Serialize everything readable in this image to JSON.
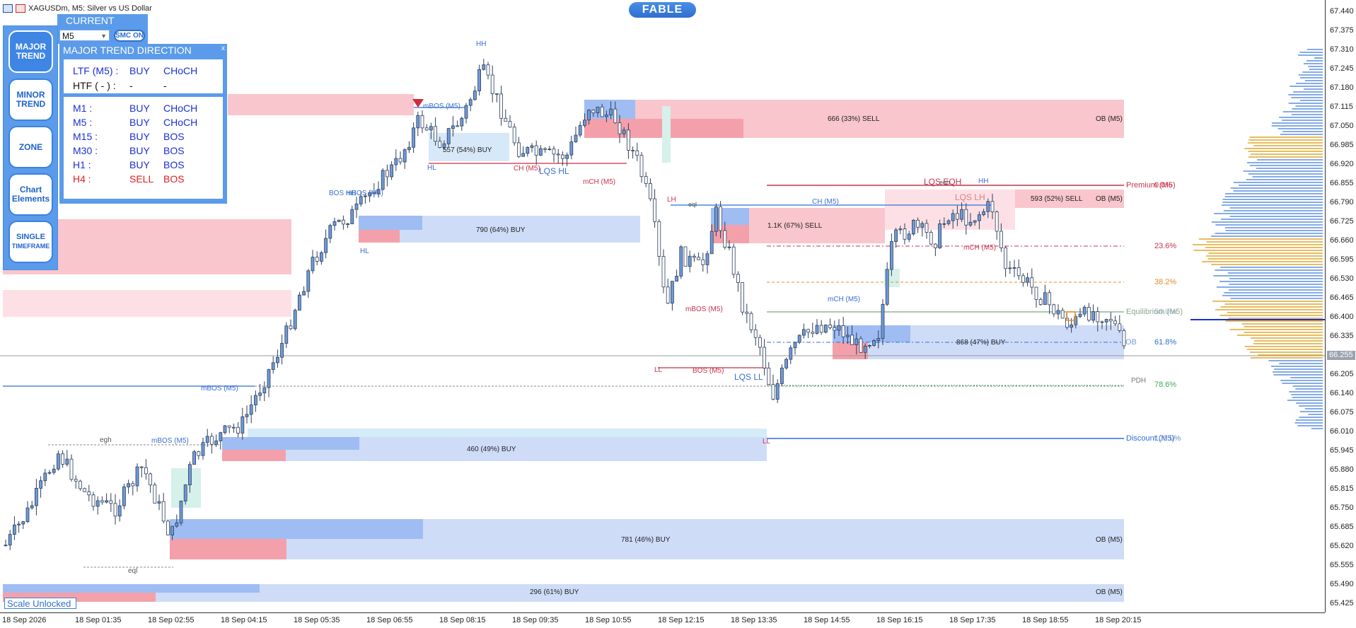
{
  "window": {
    "title": "XAGUSDm, M5:  Silver vs US Dollar",
    "brand": "FABLE"
  },
  "current": {
    "title": "CURRENT",
    "timeframe": "M5",
    "smc_label": "SMC ON"
  },
  "side_buttons": [
    {
      "label_line1": "MAJOR",
      "label_line2": "TREND",
      "active": true
    },
    {
      "label_line1": "MINOR",
      "label_line2": "TREND",
      "active": false
    },
    {
      "label_line1": "ZONE",
      "label_line2": "",
      "active": false
    },
    {
      "label_line1": "Chart",
      "label_line2": "Elements",
      "active": false
    },
    {
      "label_line1": "SINGLE",
      "label_line2": "TIMEFRAME",
      "active": false
    }
  ],
  "trend_panel": {
    "title": "MAJOR TREND DIRECTION",
    "close": "x",
    "rows_top": [
      {
        "tf": "LTF (M5) :",
        "dir": "BUY",
        "type": "CHoCH",
        "style": "blue"
      },
      {
        "tf": "HTF ( - ) :",
        "dir": "-",
        "type": "-",
        "style": "dark"
      }
    ],
    "rows": [
      {
        "tf": "M1 :",
        "dir": "BUY",
        "type": "CHoCH",
        "style": "blue"
      },
      {
        "tf": "M5 :",
        "dir": "BUY",
        "type": "CHoCH",
        "style": "blue"
      },
      {
        "tf": "M15 :",
        "dir": "BUY",
        "type": "BOS",
        "style": "blue"
      },
      {
        "tf": "M30 :",
        "dir": "BUY",
        "type": "BOS",
        "style": "blue"
      },
      {
        "tf": "H1 :",
        "dir": "BUY",
        "type": "BOS",
        "style": "blue"
      },
      {
        "tf": "H4 :",
        "dir": "SELL",
        "type": "BOS",
        "style": "red"
      }
    ]
  },
  "scale_label": "Scale Unlocked",
  "price_axis": [
    "67.440",
    "67.375",
    "67.310",
    "67.245",
    "67.180",
    "67.115",
    "67.050",
    "66.985",
    "66.920",
    "66.855",
    "66.790",
    "66.725",
    "66.660",
    "66.595",
    "66.530",
    "66.465",
    "66.400",
    "66.335",
    "66.270",
    "66.205",
    "66.140",
    "66.075",
    "66.010",
    "65.945",
    "65.880",
    "65.815",
    "65.750",
    "65.685",
    "65.620",
    "65.555",
    "65.490",
    "65.425"
  ],
  "current_price": "66.255",
  "time_axis": [
    "18 Sep 2026",
    "18 Sep 01:35",
    "18 Sep 02:55",
    "18 Sep 04:15",
    "18 Sep 05:35",
    "18 Sep 06:55",
    "18 Sep 08:15",
    "18 Sep 09:35",
    "18 Sep 10:55",
    "18 Sep 12:15",
    "18 Sep 13:35",
    "18 Sep 14:55",
    "18 Sep 16:15",
    "18 Sep 17:35",
    "18 Sep 18:55",
    "18 Sep 20:15"
  ],
  "zones": {
    "z1": "666 (33%) SELL",
    "z1_ob": "OB (M5)",
    "z2": "593 (52%) SELL",
    "z2_ob": "OB (M5)",
    "z3": "1.1K (67%) SELL",
    "z4": "790 (64%) BUY",
    "z5": "557 (54%) BUY",
    "z6": "868 (47%) BUY",
    "z7": "460 (49%) BUY",
    "z8": "781 (46%) BUY",
    "z8_ob": "OB (M5)",
    "z9": "296 (61%) BUY",
    "z9_ob": "OB (M5)"
  },
  "fib": {
    "premium": "Premium (M5)",
    "p0": "0.0%",
    "f236": "23.6%",
    "f382": "38.2%",
    "equilibrium": "Equilibrium (M5)",
    "f50": "50.0%",
    "f618": "61.8%",
    "ob": "OB",
    "f786": "78.6%",
    "pdh": "PDH",
    "discount": "Discount (M5)",
    "f100": "100.0%"
  },
  "structure": {
    "hh1": "HH",
    "hh2": "HH",
    "hl1": "HL",
    "hl2": "HL",
    "lh": "LH",
    "ll1": "LL",
    "ll2": "LL",
    "lqs_eqh": "LQS EQH",
    "lqs_lh": "LQS LH",
    "lqs_hl": "LQS HL",
    "lqs_ll": "LQS LL",
    "bos_m5": "BOS (M5)",
    "bos_hh": "BOS HH",
    "mbos1": "mBOS (M5)",
    "mbos2": "mBOS (M5)",
    "mbos3": "mBOS (M5)",
    "mbos4": "mBOS (M5)",
    "ch_m5": "CH (M5)",
    "ch_m5b": "CH (M5)",
    "mch1": "mCH (M5)",
    "mch2": "mCH (M5)",
    "mch3": "mCH (M5)",
    "egh": "egh",
    "eql": "eql",
    "eqh": "eqh",
    "eql2": "eql"
  },
  "colors": {
    "sell_zone": "#f8c6cc",
    "buy_zone": "#cfdcf8",
    "buy_strong": "#9fbcf3",
    "sell_strong": "#f4a0ab",
    "candle": "#6f9ad8",
    "panel": "#5b9bea",
    "fib_red": "#c8324b",
    "fib_orange": "#e08b28",
    "fib_green": "#3fa760"
  }
}
